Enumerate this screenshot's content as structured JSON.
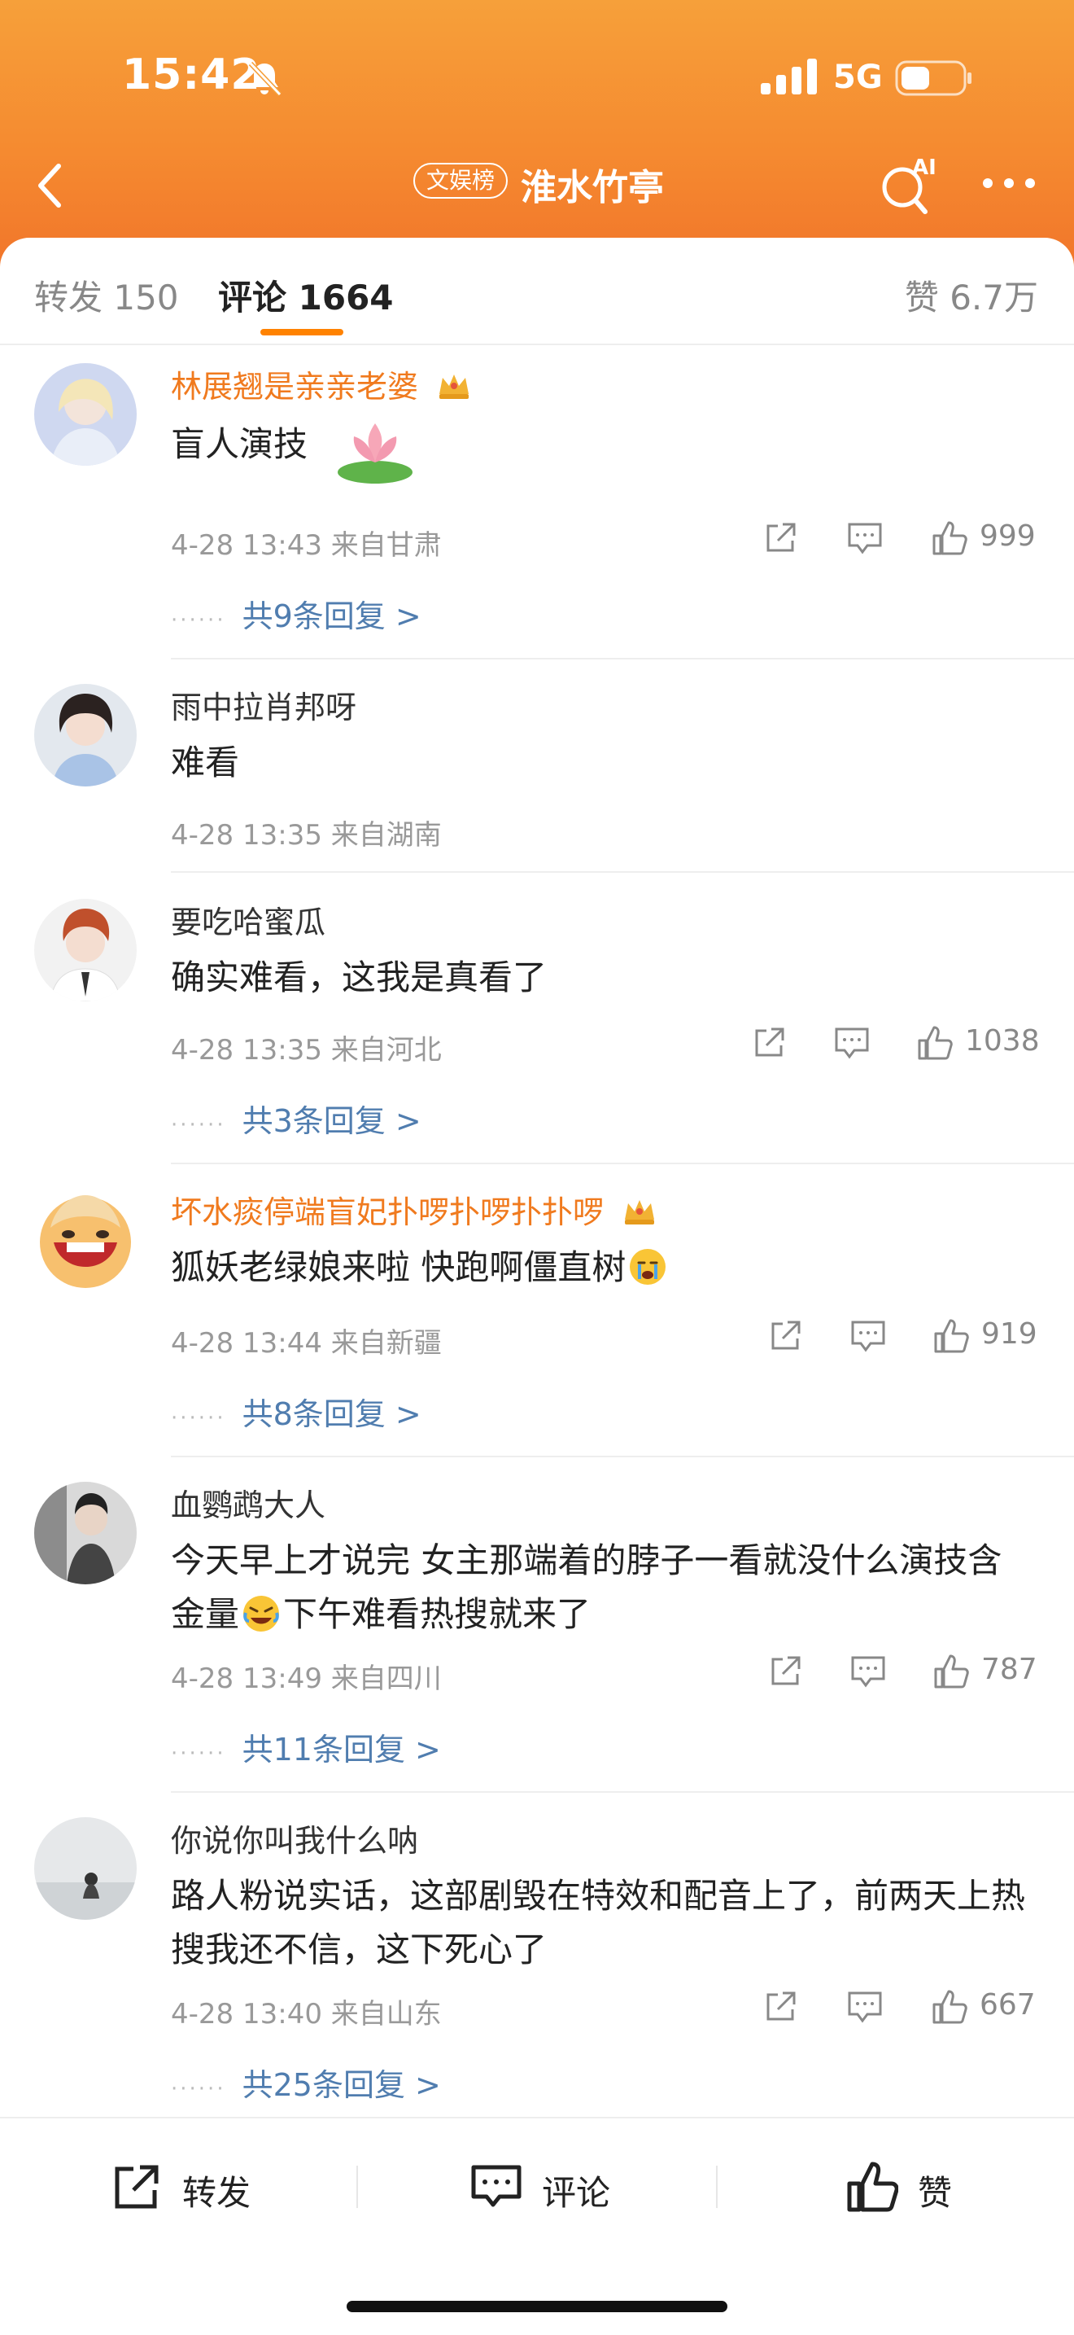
{
  "status": {
    "time": "15:42",
    "network": "5G"
  },
  "nav": {
    "badge": "文娱榜",
    "title": "淮水竹亭"
  },
  "tabs": {
    "repost": "转发 150",
    "comment": "评论 1664",
    "likes": "赞 6.7万"
  },
  "colors": {
    "accent": "#ff8200",
    "username_vip": "#f07a1e",
    "reply_link": "#507daf",
    "header_top": "#f6a03a",
    "header_bottom": "#f1742a"
  },
  "comments": [
    {
      "user": "林展翘是亲亲老婆",
      "text": "盲人演技",
      "time": "4-28 13:43 来自甘肃",
      "likes": "999",
      "replies": "共9条回复 >"
    },
    {
      "user": "雨中拉肖邦呀",
      "text": "难看",
      "time": "4-28 13:35 来自湖南"
    },
    {
      "user": "要吃哈蜜瓜",
      "text": "确实难看，这我是真看了",
      "time": "4-28 13:35 来自河北",
      "likes": "1038",
      "replies": "共3条回复 >"
    },
    {
      "user": "坏水痰停端盲妃扑啰扑啰扑扑啰",
      "text": "狐妖老绿娘来啦 快跑啊僵直树",
      "time": "4-28 13:44 来自新疆",
      "likes": "919",
      "replies": "共8条回复 >"
    },
    {
      "user": "血鹦鹉大人",
      "text_a": "今天早上才说完 女主那端着的脖子一看就没什么演技含金量",
      "text_b": "下午难看热搜就来了",
      "time": "4-28 13:49 来自四川",
      "likes": "787",
      "replies": "共11条回复 >"
    },
    {
      "user": "你说你叫我什么呐",
      "text": "路人粉说实话，这部剧毁在特效和配音上了，前两天上热搜我还不信，这下死心了",
      "time": "4-28 13:40 来自山东",
      "likes": "667",
      "replies": "共25条回复 >"
    }
  ],
  "bottom": {
    "repost": "转发",
    "comment": "评论",
    "like": "赞"
  },
  "icons": [
    "back-arrow-icon",
    "mute-bell-icon",
    "signal-icon",
    "battery-icon",
    "ai-search-icon",
    "more-icon",
    "share-icon",
    "comment-icon",
    "thumb-up-icon",
    "crown-icon"
  ]
}
